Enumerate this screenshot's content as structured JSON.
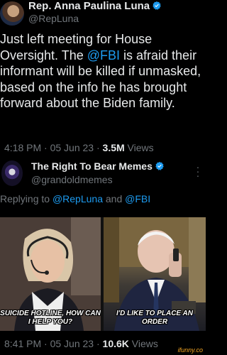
{
  "tweet": {
    "author": {
      "name": "Rep. Anna Paulina Luna",
      "handle": "@RepLuna"
    },
    "body": {
      "part1": "Just left meeting for House Oversight. The ",
      "mention": "@FBI",
      "part2": " is afraid their informant will be killed if unmasked, based on the info he has brought forward about the Biden family."
    },
    "meta": {
      "time": "4:18 PM · 05 Jun 23 · ",
      "views_count": "3.5M",
      "views_label": " Views"
    }
  },
  "reply": {
    "author": {
      "name": "The Right To Bear Memes",
      "handle": "@grandoldmemes"
    },
    "replying_prefix": "Replying to ",
    "replying_to_1": "@RepLuna",
    "replying_and": " and ",
    "replying_to_2": "@FBI",
    "meme": {
      "left_caption": "SUICIDE HOTLINE, HOW CAN I HELP YOU?",
      "right_caption": "I'D LIKE TO PLACE AN ORDER"
    },
    "meta": {
      "time": "8:41 PM · 05 Jun 23 · ",
      "views_count": "10.6K",
      "views_label": " Views"
    }
  },
  "watermark": "ifunny.co",
  "colors": {
    "accent": "#1d9bf0",
    "secondary_text": "#71767b",
    "background": "#000000",
    "verified": "#1d9bf0"
  },
  "icons": {
    "verified": "verified-badge-icon",
    "more": "more-options-icon"
  }
}
